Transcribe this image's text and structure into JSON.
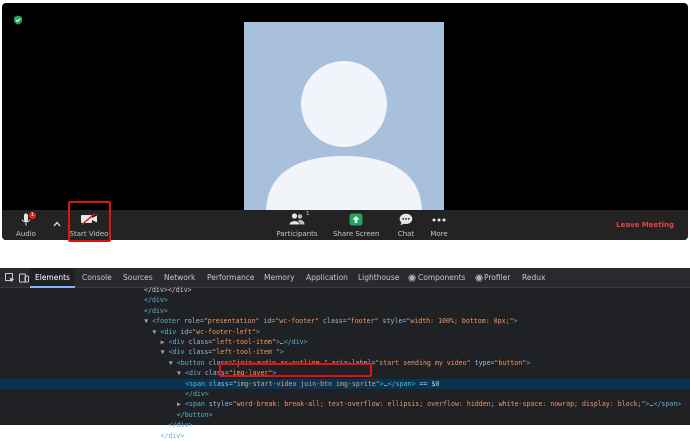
{
  "footer": {
    "audio_label": "Audio",
    "audio_badge": "1",
    "start_video_label": "Start Video",
    "participants_label": "Participants",
    "participants_count": "1",
    "share_screen_label": "Share Screen",
    "chat_label": "Chat",
    "more_label": "More",
    "leave_label": "Leave Meeting"
  },
  "devtools": {
    "tabs": [
      "Elements",
      "Console",
      "Sources",
      "Network",
      "Performance",
      "Memory",
      "Application",
      "Lighthouse",
      "Components",
      "Profiler",
      "Redux"
    ],
    "active_tab": "Elements",
    "dom_lines": [
      {
        "indent": 0,
        "parts": [
          [
            "txt",
            "</div></div>"
          ]
        ]
      },
      {
        "indent": 0,
        "parts": [
          [
            "tag",
            "</div>"
          ]
        ]
      },
      {
        "indent": 0,
        "parts": [
          [
            "tag",
            "</div>"
          ]
        ]
      },
      {
        "indent": 1,
        "tri": "▼",
        "parts": [
          [
            "tag",
            "<footer "
          ],
          [
            "attr",
            "role="
          ],
          [
            "val",
            "\"presentation\" "
          ],
          [
            "attr",
            "id="
          ],
          [
            "val",
            "\"wc-footer\" "
          ],
          [
            "attr",
            "class="
          ],
          [
            "val",
            "\"footer\" "
          ],
          [
            "attr",
            "style="
          ],
          [
            "val",
            "\"width: 100%; bottom: 0px;\""
          ],
          [
            "tag",
            ">"
          ]
        ]
      },
      {
        "indent": 2,
        "tri": "▼",
        "parts": [
          [
            "tag",
            "<div "
          ],
          [
            "attr",
            "id="
          ],
          [
            "val",
            "\"wc-footer-left\""
          ],
          [
            "tag",
            ">"
          ]
        ]
      },
      {
        "indent": 3,
        "tri": "▶",
        "parts": [
          [
            "tag",
            "<div "
          ],
          [
            "attr",
            "class="
          ],
          [
            "val",
            "\"left-tool-item\""
          ],
          [
            "tag",
            ">"
          ],
          [
            "txt",
            "…"
          ],
          [
            "tag",
            "</div>"
          ]
        ]
      },
      {
        "indent": 3,
        "tri": "▼",
        "parts": [
          [
            "tag",
            "<div "
          ],
          [
            "attr",
            "class="
          ],
          [
            "val",
            "\"left-tool-item \""
          ],
          [
            "tag",
            ">"
          ]
        ]
      },
      {
        "indent": 4,
        "tri": "▼",
        "parts": [
          [
            "tag",
            "<button "
          ],
          [
            "attr",
            "class="
          ],
          [
            "val",
            "\"join-audio ax-outline \" "
          ],
          [
            "attr",
            "aria-label="
          ],
          [
            "val",
            "\"start sending my video\" "
          ],
          [
            "attr",
            "type="
          ],
          [
            "val",
            "\"button\""
          ],
          [
            "tag",
            ">"
          ]
        ]
      },
      {
        "indent": 5,
        "tri": "▼",
        "parts": [
          [
            "tag",
            "<div "
          ],
          [
            "attr",
            "class="
          ],
          [
            "val",
            "\"img-layer\""
          ],
          [
            "tag",
            ">"
          ]
        ]
      },
      {
        "indent": 6,
        "sel": true,
        "parts": [
          [
            "tag",
            "<span "
          ],
          [
            "attr",
            "class="
          ],
          [
            "val",
            "\"img-start-video join-btn img-sprite\""
          ],
          [
            "tag",
            ">"
          ],
          [
            "txt",
            "…"
          ],
          [
            "tag",
            "</span>"
          ],
          [
            "txt",
            " == $0"
          ]
        ]
      },
      {
        "indent": 5,
        "parts": [
          [
            "tag",
            "</div>"
          ]
        ]
      },
      {
        "indent": 5,
        "tri": "▶",
        "parts": [
          [
            "tag",
            "<span "
          ],
          [
            "attr",
            "style="
          ],
          [
            "val",
            "\"word-break: break-all; text-overflow: ellipsis; overflow: hidden; white-space: nowrap; display: block;\""
          ],
          [
            "tag",
            ">"
          ],
          [
            "txt",
            "…"
          ],
          [
            "tag",
            "</span>"
          ]
        ]
      },
      {
        "indent": 4,
        "parts": [
          [
            "tag",
            "</button>"
          ]
        ]
      },
      {
        "indent": 3,
        "parts": [
          [
            "tag",
            "</div>"
          ]
        ]
      },
      {
        "indent": 2,
        "parts": [
          [
            "tag",
            "</div>"
          ]
        ]
      }
    ]
  },
  "colors": {
    "meeting_bg": "#000000",
    "footer_bg": "#232323",
    "leave_text": "#e8403e",
    "share_green": "#23a55a",
    "highlight_red": "#e31111",
    "devtools_bg": "#202124",
    "selected_row": "#073655"
  }
}
